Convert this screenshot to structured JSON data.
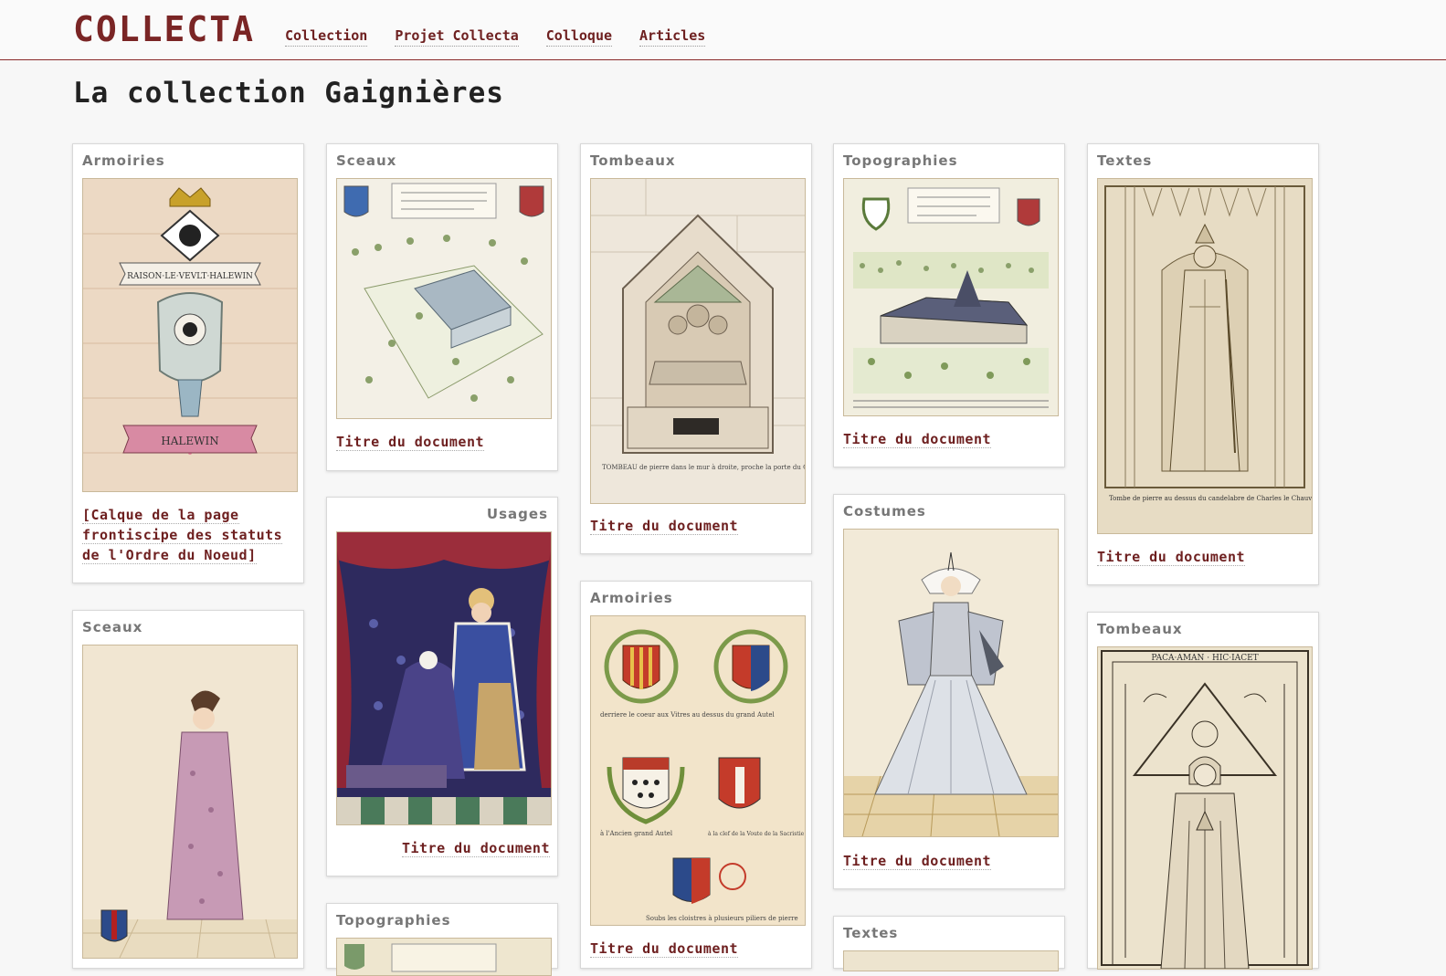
{
  "header": {
    "brand": "COLLECTA",
    "nav": [
      "Collection",
      "Projet Collecta",
      "Colloque",
      "Articles"
    ]
  },
  "page": {
    "title": "La collection Gaignières"
  },
  "colors": {
    "accent": "#7a2525",
    "link": "#6e2020",
    "category": "#777777"
  },
  "cards": [
    {
      "category": "Armoiries",
      "title": "[Calque de la page frontiscipe des statuts de l'Ordre du Noeud]"
    },
    {
      "category": "Sceaux",
      "title": ""
    },
    {
      "category": "Sceaux",
      "title": "Titre du document"
    },
    {
      "category": "Usages",
      "title": "Titre du document"
    },
    {
      "category": "Topographies",
      "title": ""
    },
    {
      "category": "Tombeaux",
      "title": "Titre du document"
    },
    {
      "category": "Armoiries",
      "title": "Titre du document"
    },
    {
      "category": "Topographies",
      "title": "Titre du document"
    },
    {
      "category": "Costumes",
      "title": "Titre du document"
    },
    {
      "category": "Textes",
      "title": ""
    },
    {
      "category": "Textes",
      "title": "Titre du document"
    },
    {
      "category": "Tombeaux",
      "title": ""
    }
  ],
  "image_text": {
    "halewin_motto": "RAISON·LE·VEVLT·HALEWIN",
    "halewin_banner": "HALEWIN",
    "tombeau_caption": "TOMBEAU de pierre dans le mur à droite, proche la porte du Choeur",
    "arm_caption_1": "derriere le coeur aux Vitres au dessus du grand Autel",
    "arm_caption_2": "à l'Ancien grand Autel",
    "arm_caption_3": "à la clef de la Voute de la Sacristie",
    "arm_caption_4": "Soubs les cloistres à plusieurs piliers de pierre",
    "textes_caption": "Tombe de pierre au dessus du candelabre de Charles le Chauve",
    "tombeau2_top": "PACA·AMAN · HIC·IACET"
  }
}
